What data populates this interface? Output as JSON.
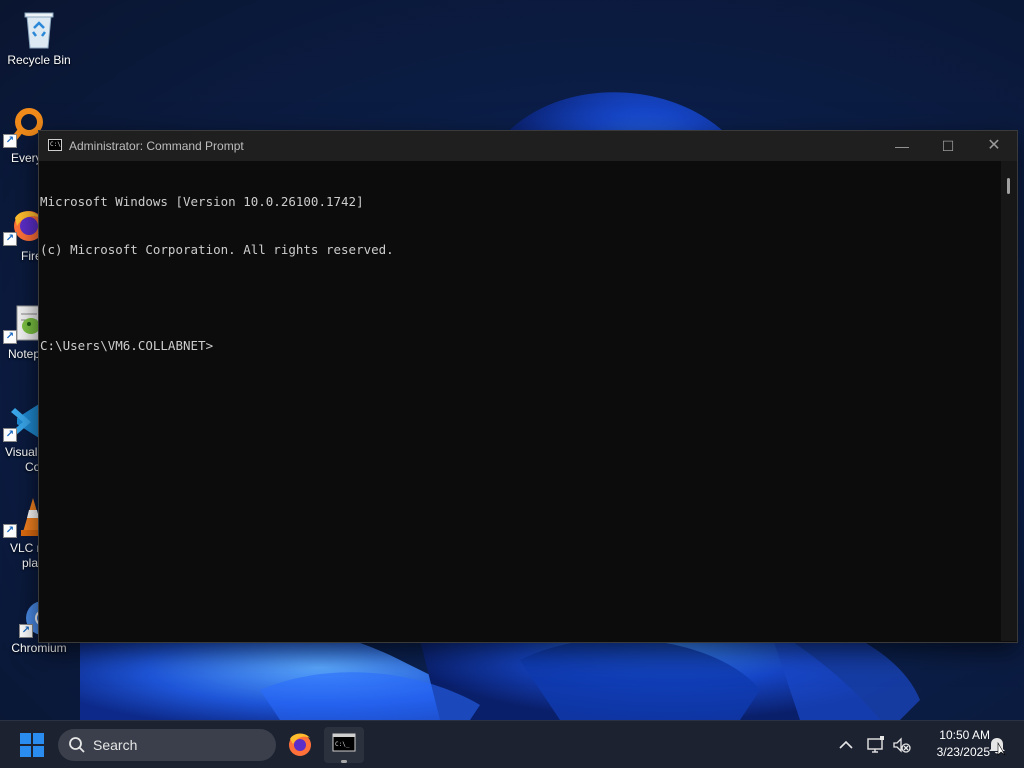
{
  "desktop": {
    "icons": [
      {
        "label": "Recycle Bin",
        "icon": "recycle-bin-icon"
      },
      {
        "label": "Every",
        "icon": "everything-search-icon"
      },
      {
        "label": "Fire",
        "icon": "firefox-icon"
      },
      {
        "label": "Notep",
        "icon": "notepad-plus-plus-icon"
      },
      {
        "label": "Visual",
        "label2": "Co",
        "icon": "visual-studio-code-icon"
      },
      {
        "label": "VLC r",
        "label2": "pla",
        "icon": "vlc-icon"
      },
      {
        "label": "Chromium",
        "icon": "chromium-icon"
      }
    ]
  },
  "window": {
    "title": "Administrator: Command Prompt",
    "icon": "command-prompt-icon",
    "controls": {
      "minimize": "—",
      "maximize": "☐",
      "close": "✕"
    },
    "console_lines": [
      "Microsoft Windows [Version 10.0.26100.1742]",
      "(c) Microsoft Corporation. All rights reserved.",
      "",
      "C:\\Users\\VM6.COLLABNET>"
    ]
  },
  "taskbar": {
    "search_placeholder": "Search",
    "apps": [
      "firefox-icon",
      "command-prompt-icon"
    ],
    "tray": {
      "overflow": "^",
      "time": "10:50 AM",
      "date": "3/23/2025"
    }
  },
  "colors": {
    "console_bg": "#0c0c0c",
    "console_text": "#cccccc",
    "titlebar_bg": "#1f1f1f",
    "taskbar_bg": "#1c2230",
    "windows_accent": "#2b8cf0"
  }
}
